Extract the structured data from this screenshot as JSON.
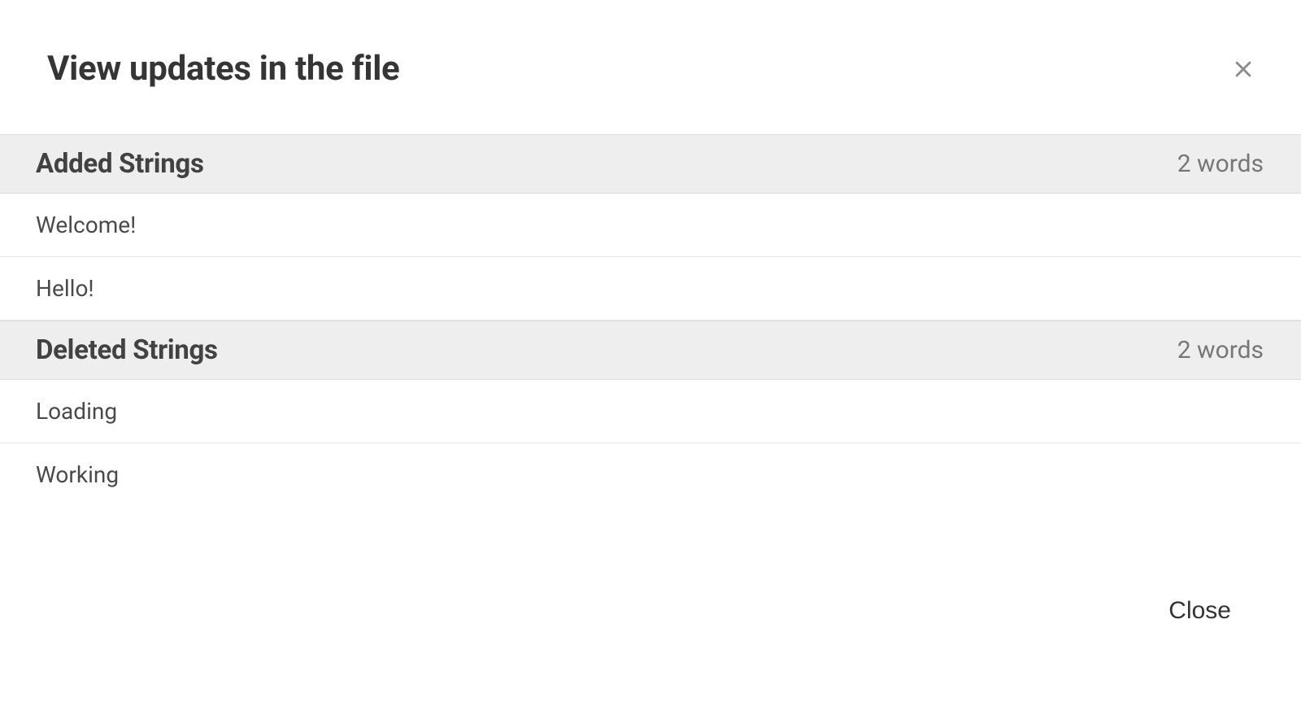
{
  "header": {
    "title": "View updates in the file"
  },
  "sections": {
    "added": {
      "title": "Added Strings",
      "count": "2 words",
      "items": [
        "Welcome!",
        "Hello!"
      ]
    },
    "deleted": {
      "title": "Deleted Strings",
      "count": "2 words",
      "items": [
        "Loading",
        "Working"
      ]
    }
  },
  "footer": {
    "close_label": "Close"
  }
}
